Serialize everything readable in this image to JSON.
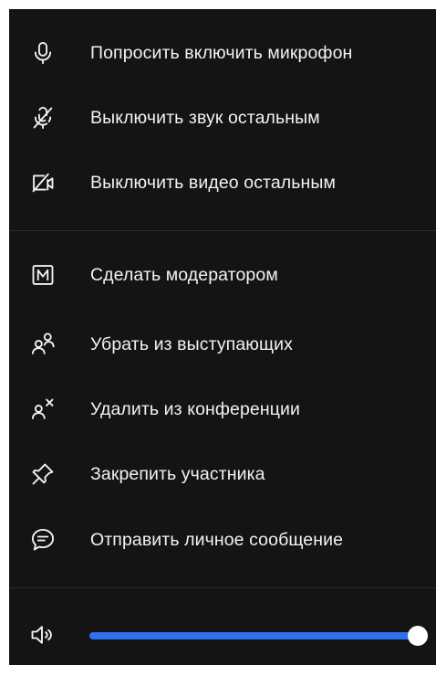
{
  "menu": {
    "group1": [
      {
        "icon": "microphone-icon",
        "label": "Попросить включить микрофон"
      },
      {
        "icon": "microphone-off-icon",
        "label": "Выключить звук остальным"
      },
      {
        "icon": "camera-off-icon",
        "label": "Выключить видео остальным"
      }
    ],
    "group2": [
      {
        "icon": "moderator-m-icon",
        "label": "Сделать модератором"
      },
      {
        "icon": "users-icon",
        "label": "Убрать из выступающих"
      },
      {
        "icon": "user-remove-icon",
        "label": "Удалить из конференции"
      },
      {
        "icon": "pin-icon",
        "label": "Закрепить участника"
      },
      {
        "icon": "message-icon",
        "label": "Отправить личное сообщение"
      }
    ]
  },
  "volume": {
    "icon": "speaker-icon",
    "level": 1.0
  },
  "colors": {
    "background": "#141414",
    "text": "#f2f2f2",
    "accent": "#2f6ff0",
    "divider": "#2e2e2e"
  }
}
